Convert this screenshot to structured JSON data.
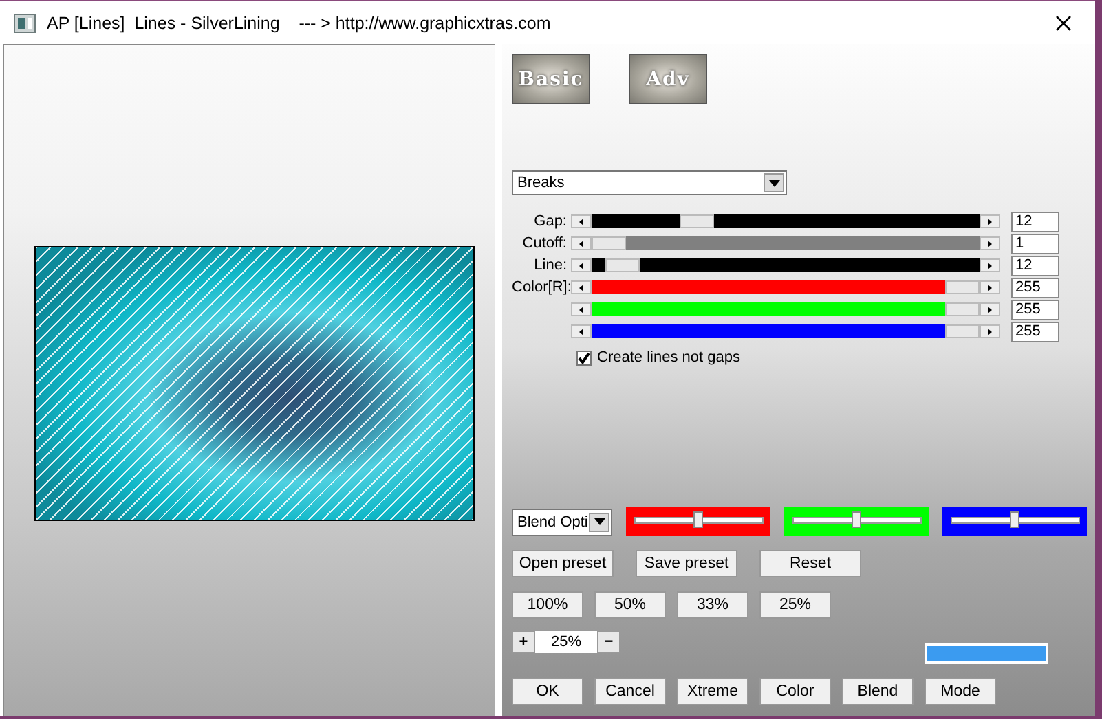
{
  "window": {
    "title": "AP [Lines]  Lines - SilverLining    --- > http://www.graphicxtras.com"
  },
  "mode_buttons": [
    {
      "label": "Basic",
      "selected": false
    },
    {
      "label": "Adv",
      "selected": false
    }
  ],
  "effect_dropdown": {
    "value": "Breaks"
  },
  "sliders": [
    {
      "label": "Gap:",
      "color": "#000000",
      "level": 0.25,
      "value": "12"
    },
    {
      "label": "Cutoff:",
      "color": "#808080",
      "level": 0.0,
      "value": "1"
    },
    {
      "label": "Line:",
      "color": "#000000",
      "level": 0.04,
      "value": "12"
    },
    {
      "label": "Color[R]:",
      "color": "#ff0000",
      "level": 1.0,
      "value": "255"
    },
    {
      "color": "#00ff00",
      "level": 1.0,
      "value": "255"
    },
    {
      "color": "#0000ff",
      "level": 1.0,
      "value": "255"
    }
  ],
  "create_lines_checkbox": {
    "label": "Create lines not gaps",
    "checked": true
  },
  "blend_dropdown": {
    "value": "Blend Opti"
  },
  "channel_sliders": [
    {
      "color": "#ff0000",
      "level": 0.5
    },
    {
      "color": "#00ff00",
      "level": 0.5
    },
    {
      "color": "#0000ff",
      "level": 0.5
    }
  ],
  "preset_buttons": [
    "Open preset",
    "Save preset",
    "Reset"
  ],
  "zoom_buttons": [
    "100%",
    "50%",
    "33%",
    "25%"
  ],
  "zoom_control": {
    "plus": "+",
    "value": "25%",
    "minus": "−"
  },
  "swatch": {
    "color": "#3b9bf0"
  },
  "action_buttons": [
    "OK",
    "Cancel",
    "Xtreme",
    "Color",
    "Blend",
    "Mode"
  ]
}
